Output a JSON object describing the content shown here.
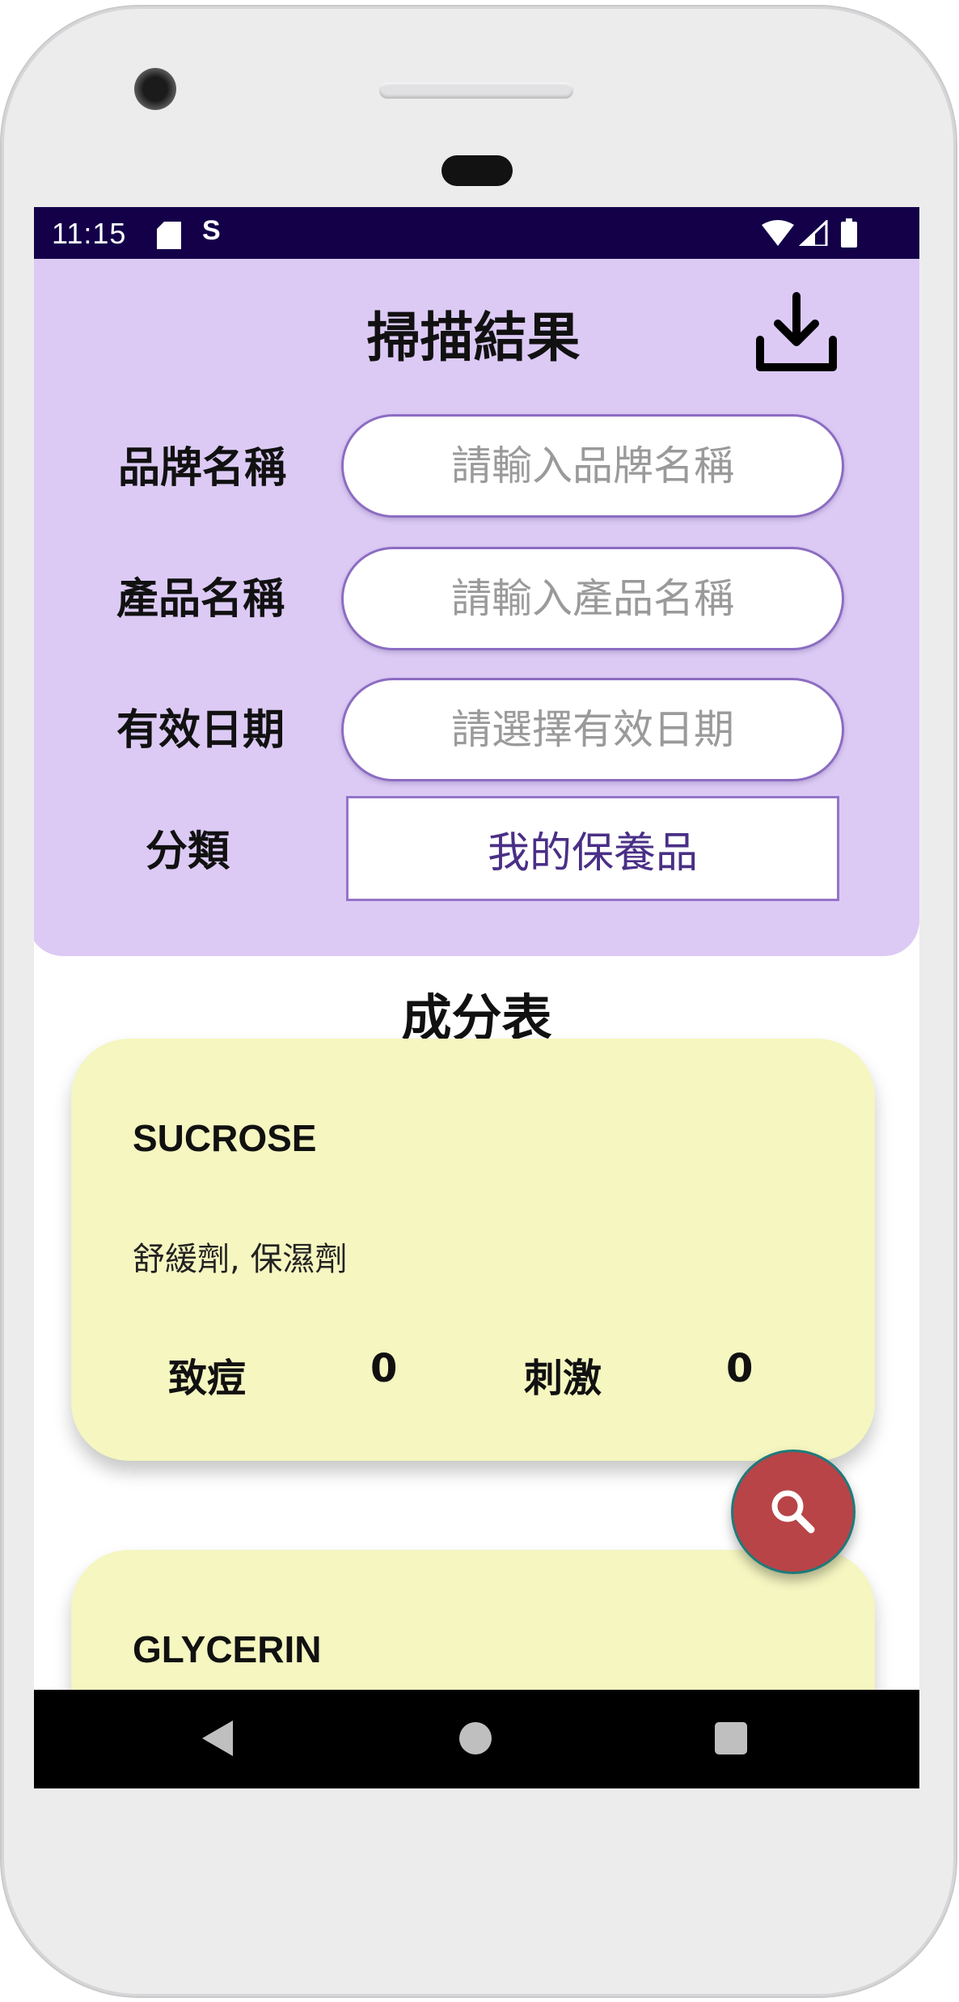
{
  "status_bar": {
    "time": "11:15",
    "extra_icon": "S"
  },
  "header": {
    "title": "掃描結果"
  },
  "form": {
    "brand": {
      "label": "品牌名稱",
      "placeholder": "請輸入品牌名稱",
      "value": ""
    },
    "product": {
      "label": "產品名稱",
      "placeholder": "請輸入產品名稱",
      "value": ""
    },
    "expiry": {
      "label": "有效日期",
      "placeholder": "請選擇有效日期",
      "value": ""
    },
    "category": {
      "label": "分類",
      "value": "我的保養品"
    }
  },
  "ingredients_section": {
    "title": "成分表"
  },
  "ingredients": [
    {
      "name": "SUCROSE",
      "function": "舒緩劑, 保濕劑",
      "acne_label": "致痘",
      "acne_value": "0",
      "irritation_label": "刺激",
      "irritation_value": "0"
    },
    {
      "name": "GLYCERIN"
    }
  ],
  "icons": {
    "download": "download-icon",
    "search": "search-icon",
    "back": "back-triangle-icon",
    "home": "home-circle-icon",
    "recents": "recents-square-icon"
  },
  "colors": {
    "status_bar": "#130049",
    "header_panel": "#dccaf5",
    "card": "#f5f6c0",
    "fab": "#b84447",
    "input_border": "#8c6cc2"
  }
}
